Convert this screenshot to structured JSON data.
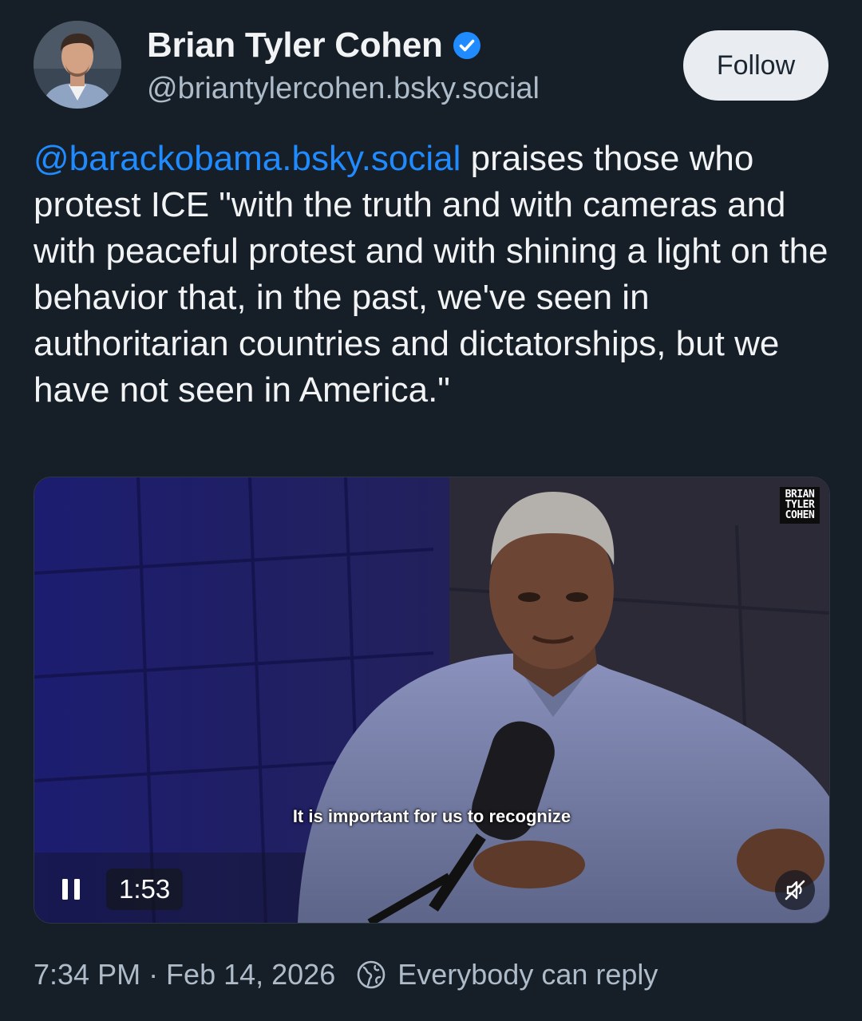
{
  "author": {
    "display_name": "Brian Tyler Cohen",
    "handle": "@briantylercohen.bsky.social",
    "verified": true,
    "avatar_icon": "profile-photo"
  },
  "follow_button": {
    "label": "Follow"
  },
  "post": {
    "mention": "@barackobama.bsky.social",
    "text": " praises those who protest ICE \"with the truth and with cameras and with peaceful protest and with shining a light on the behavior that, in the past, we've seen in authoritarian countries and dictatorships, but we have not seen in America.\""
  },
  "video": {
    "watermark": [
      "BRIAN",
      "TYLER",
      "COHEN"
    ],
    "caption": "It is important for us to recognize",
    "duration": "1:53",
    "state": "playing",
    "muted": true
  },
  "footer": {
    "timestamp": "7:34 PM · Feb 14, 2026",
    "reply_setting": "Everybody can reply"
  },
  "colors": {
    "background": "#161e27",
    "link": "#208bfe",
    "muted_text": "#aebbc9",
    "verified_badge": "#208bfe",
    "follow_button_bg": "#e9edf1"
  }
}
